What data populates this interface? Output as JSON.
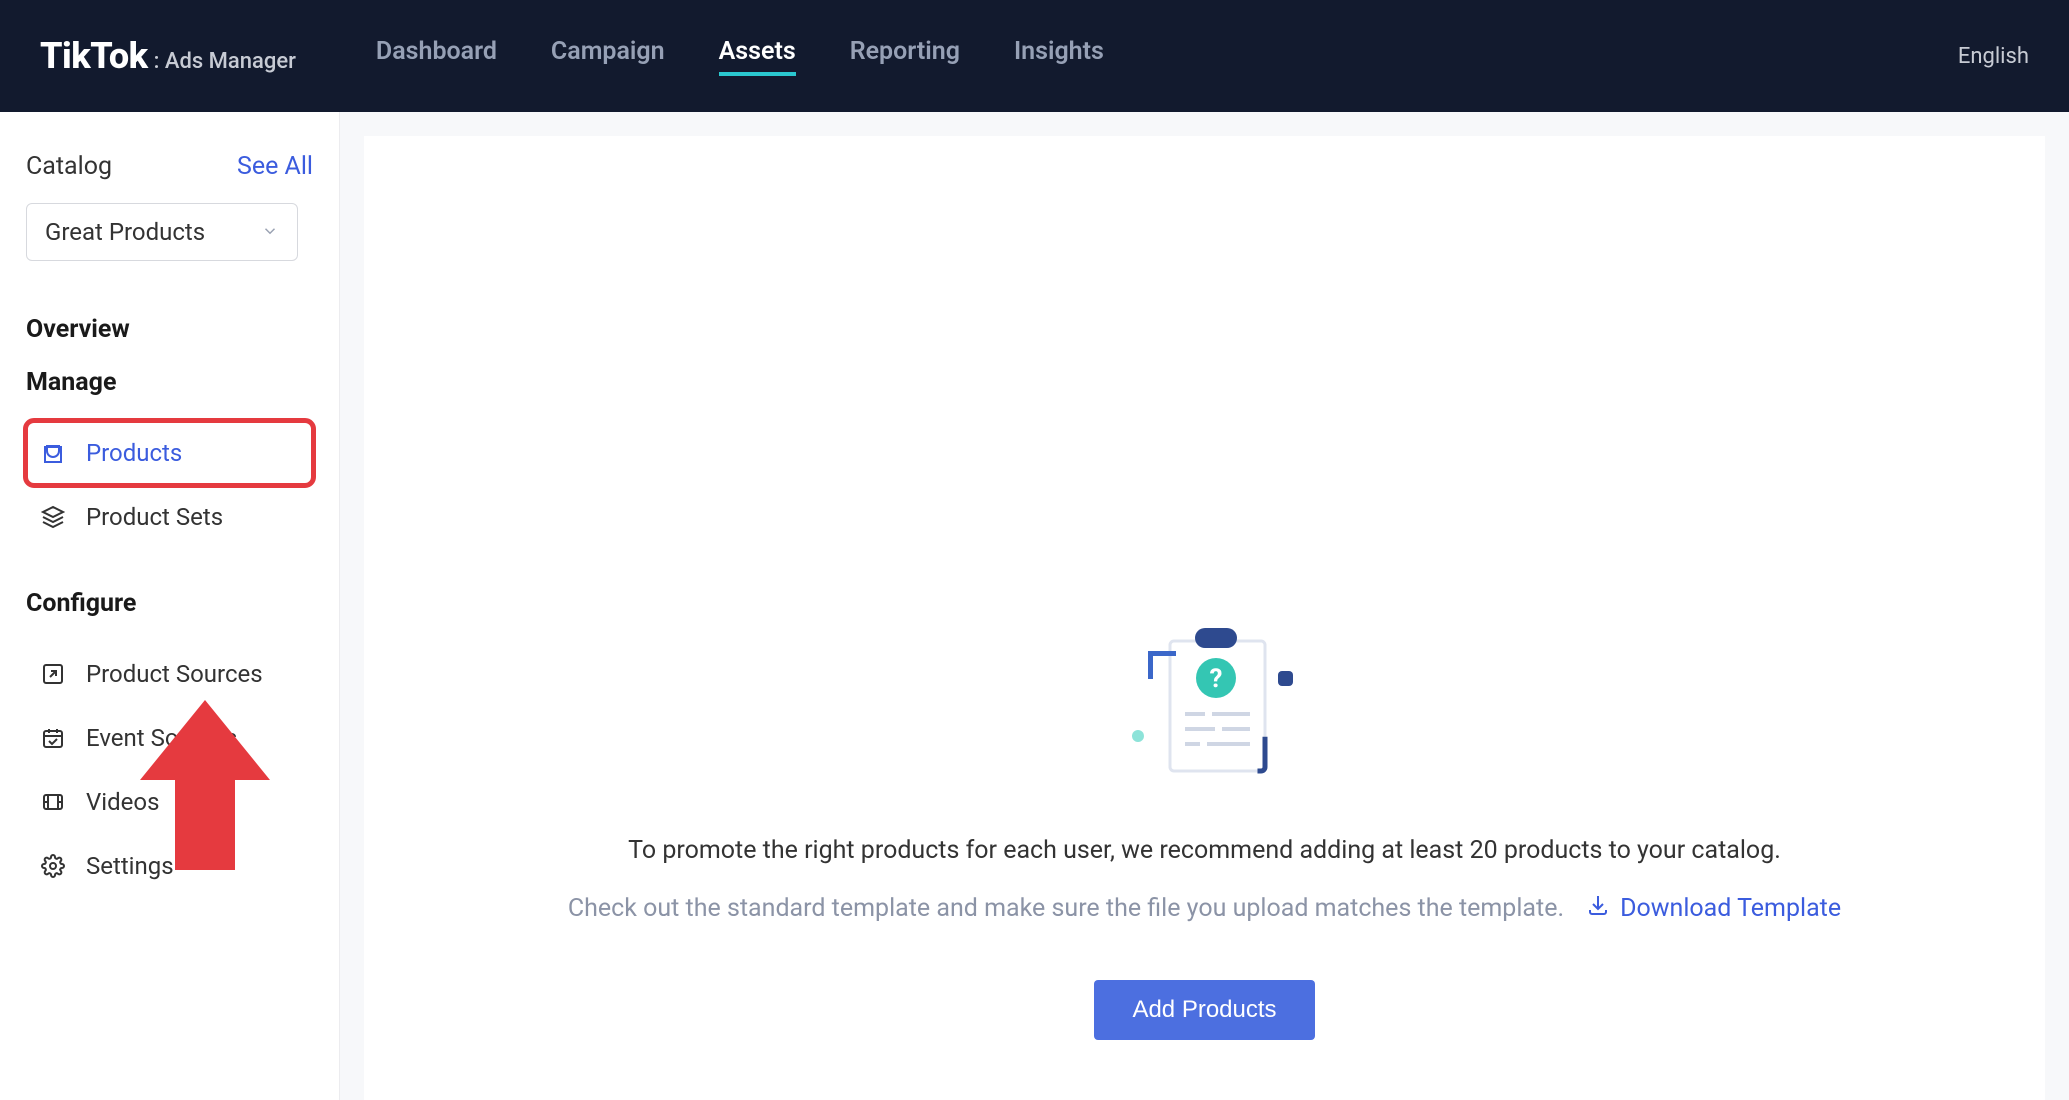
{
  "header": {
    "brand_main": "TikTok",
    "brand_sep": ":",
    "brand_sub": "Ads Manager",
    "nav": [
      {
        "label": "Dashboard",
        "active": false
      },
      {
        "label": "Campaign",
        "active": false
      },
      {
        "label": "Assets",
        "active": true
      },
      {
        "label": "Reporting",
        "active": false
      },
      {
        "label": "Insights",
        "active": false
      }
    ],
    "language": "English"
  },
  "sidebar": {
    "catalog_label": "Catalog",
    "see_all": "See All",
    "catalog_selected": "Great Products",
    "sections": {
      "overview": "Overview",
      "manage": "Manage",
      "manage_items": [
        {
          "key": "products",
          "label": "Products",
          "active": true
        },
        {
          "key": "product-sets",
          "label": "Product Sets",
          "active": false
        }
      ],
      "configure": "Configure",
      "configure_items": [
        {
          "key": "product-sources",
          "label": "Product Sources"
        },
        {
          "key": "event-sources",
          "label": "Event Sources"
        },
        {
          "key": "videos",
          "label": "Videos"
        },
        {
          "key": "settings",
          "label": "Settings"
        }
      ]
    }
  },
  "main": {
    "title": "To promote the right products for each user, we recommend adding at least 20 products to your catalog.",
    "subtitle": "Check out the standard template and make sure the file you upload matches the template.",
    "download_label": "Download Template",
    "add_button": "Add Products"
  }
}
